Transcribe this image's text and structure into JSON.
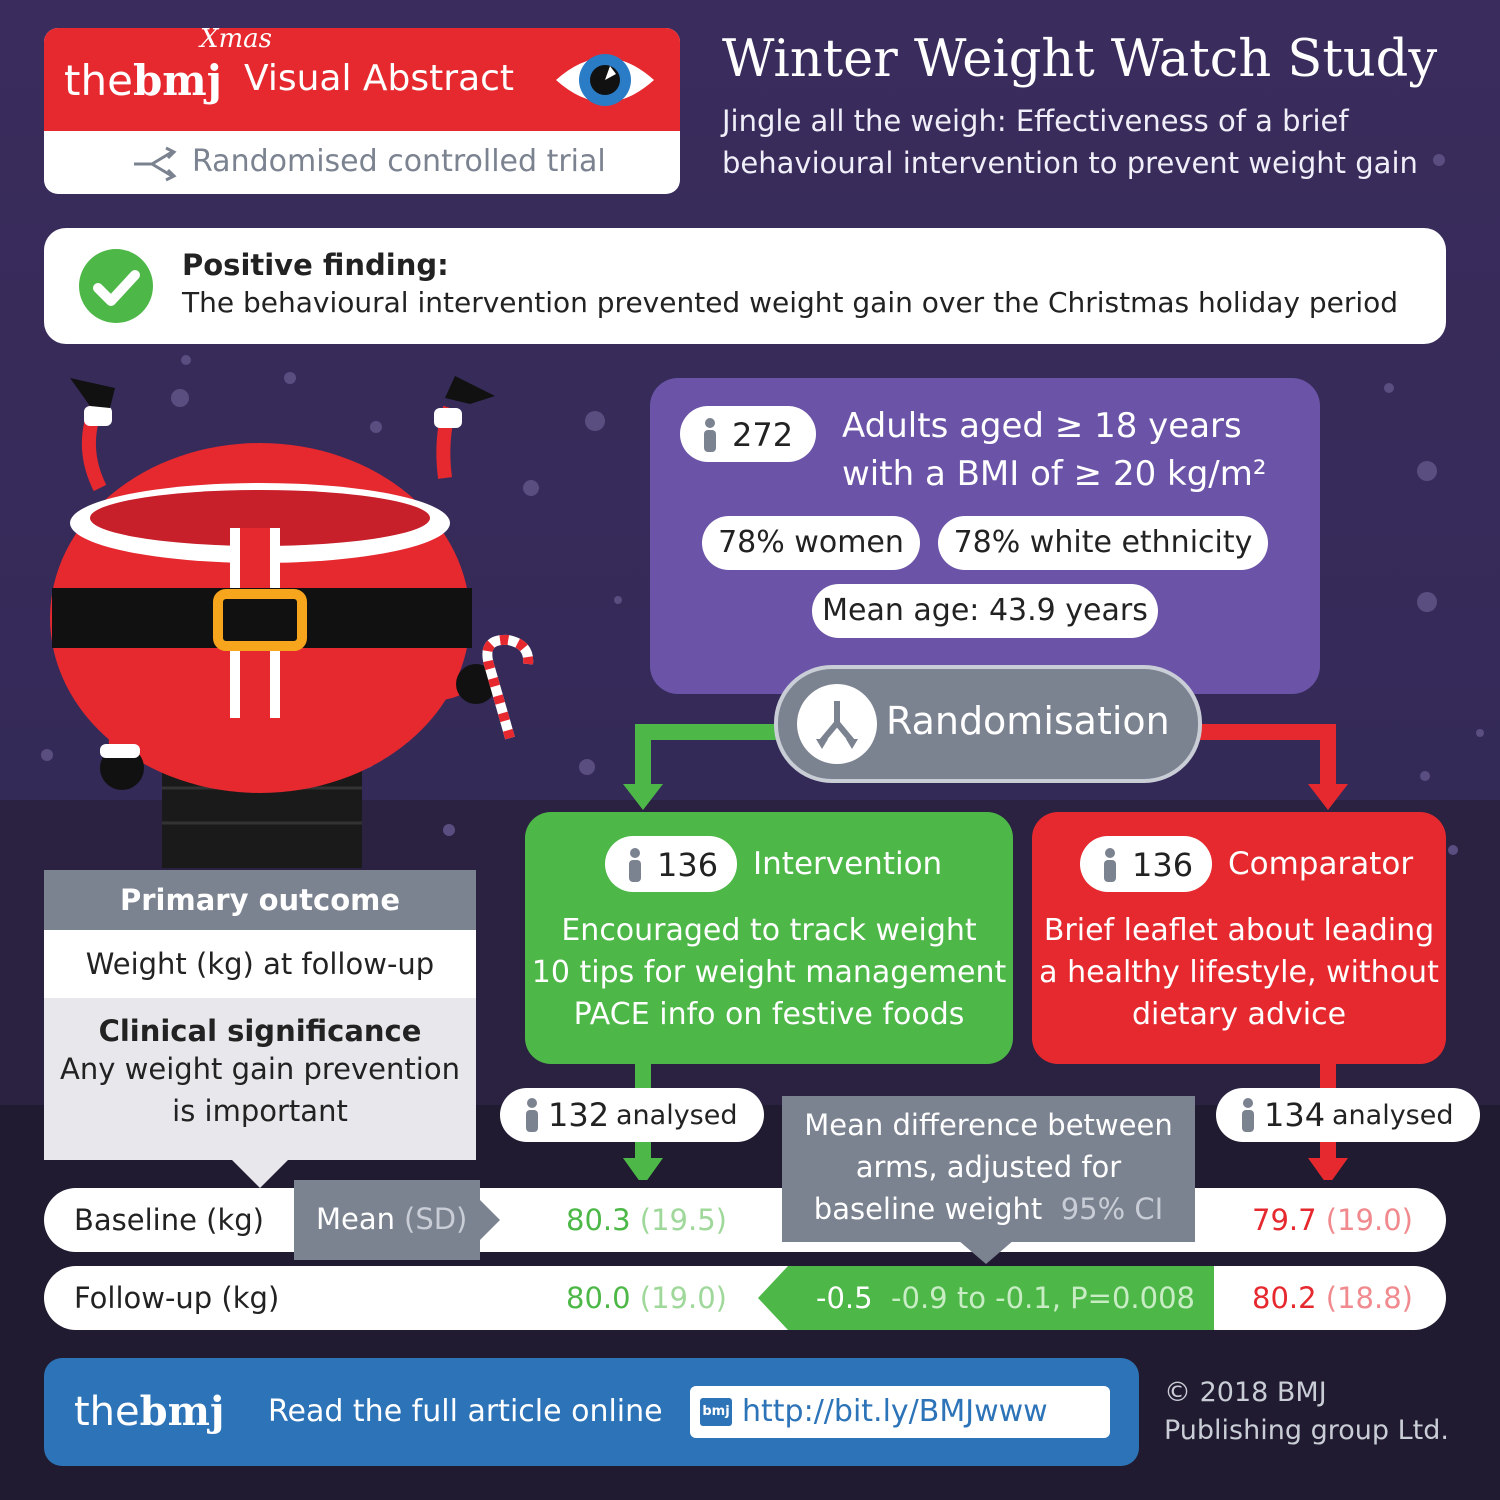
{
  "header": {
    "brand_the": "the",
    "brand_bmj": "bmj",
    "brand_xmas": "Xmas",
    "brand_visual_abstract": "Visual Abstract",
    "study_type": "Randomised controlled trial",
    "title": "Winter Weight Watch Study",
    "subtitle_line1": "Jingle all the weigh: Effectiveness of a brief",
    "subtitle_line2": "behavioural intervention to prevent weight gain"
  },
  "finding": {
    "heading": "Positive finding:",
    "text": "The behavioural intervention prevented weight gain over the Christmas holiday period"
  },
  "population": {
    "count": "272",
    "description_line1": "Adults aged ≥ 18 years",
    "description_line2": "with a BMI of ≥ 20 kg/m²",
    "women": "78% women",
    "ethnicity": "78% white ethnicity",
    "mean_age": "Mean age: 43.9 years"
  },
  "randomisation": {
    "label": "Randomisation"
  },
  "intervention": {
    "count": "136",
    "label": "Intervention",
    "line1": "Encouraged to track weight",
    "line2": "10 tips for weight management",
    "line3": "PACE info on festive foods",
    "analysed_count": "132",
    "analysed_label": "analysed",
    "baseline_mean": "80.3",
    "baseline_sd": "(19.5)",
    "followup_mean": "80.0",
    "followup_sd": "(19.0)"
  },
  "comparator": {
    "count": "136",
    "label": "Comparator",
    "line1": "Brief leaflet about leading",
    "line2": "a healthy lifestyle, without",
    "line3": "dietary advice",
    "analysed_count": "134",
    "analysed_label": "analysed",
    "baseline_mean": "79.7",
    "baseline_sd": "(19.0)",
    "followup_mean": "80.2",
    "followup_sd": "(18.8)"
  },
  "outcome": {
    "primary_heading": "Primary outcome",
    "primary_value": "Weight (kg) at follow-up",
    "clinical_heading": "Clinical significance",
    "clinical_line1": "Any weight gain prevention",
    "clinical_line2": "is important"
  },
  "table": {
    "baseline_label": "Baseline (kg)",
    "followup_label": "Follow-up (kg)",
    "mean_label": "Mean",
    "sd_label": "(SD)",
    "diff_line1": "Mean difference between",
    "diff_line2": "arms, adjusted for",
    "diff_line3": "baseline weight",
    "ci_label": "95% CI",
    "diff_value": "-0.5",
    "diff_ci": "-0.9 to -0.1, P=0.008"
  },
  "footer": {
    "brand_the": "the",
    "brand_bmj": "bmj",
    "cta": "Read the full article online",
    "url_badge": "bmj",
    "url": "http://bit.ly/BMJwww",
    "copyright_line1": "© 2018 BMJ",
    "copyright_line2": "Publishing group Ltd."
  },
  "colors": {
    "background": "#3a2c5c",
    "brand_red": "#e5292f",
    "intervention_green": "#4db848",
    "comparator_red": "#e5292f",
    "population_purple": "#6b54a8",
    "footer_blue": "#2c73b8",
    "grey_box": "#7b8290"
  },
  "icons": [
    "eye-icon",
    "shuffle-icon",
    "check-icon",
    "person-icon",
    "merge-arrows-icon",
    "santa-illustration"
  ]
}
